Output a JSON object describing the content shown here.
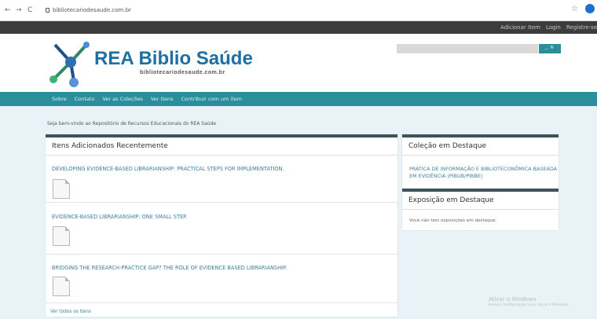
{
  "browser": {
    "back": "←",
    "forward": "→",
    "reload": "C",
    "url": "bibliotecariodesaude.com.br",
    "star_icon": "star-icon",
    "profile_icon": "profile-icon"
  },
  "topbar": {
    "links": [
      "Adicionar Item",
      "Login",
      "Registre-se"
    ]
  },
  "header": {
    "logo_title": "REA Biblio Saúde",
    "logo_subtitle": "bibliotecariodesaude.com.br",
    "search_button": "... 🔍"
  },
  "nav": {
    "items": [
      "Sobre",
      "Contato",
      "Ver as Coleções",
      "Ver Itens",
      "Contribuir com um item"
    ]
  },
  "welcome": "Seja bem-vindo ao Repositório de Recursos Educacionais do REA Saúde",
  "recent": {
    "title": "Itens Adicionados Recentemente",
    "items": [
      "DEVELOPING EVIDENCE-BASED LIBRARIANSHIP: PRACTICAL STEPS FOR IMPLEMENTATION.",
      "EVIDENCE-BASED LIBRARIANSHIP: ONE SMALL STEP.",
      "BRIDGING THE RESEARCH-PRACTICE GAP? THE ROLE OF EVIDENCE BASED LIBRARIANSHIP."
    ],
    "view_all": "Ver todos os itens"
  },
  "featured_collection": {
    "title": "Coleção em Destaque",
    "link": "PRÁTICA DE INFORMAÇÃO E BIBLIOTECONÔMICA BASEADA EM EVIDÊNCIA (PIBUB/PIBBE)"
  },
  "featured_exhibit": {
    "title": "Exposição em Destaque",
    "message": "Você não tem exposições em destaque."
  },
  "watermark": {
    "line1": "Ativar o Windows",
    "line2": "Acesse Configurações para ativar o Windows."
  },
  "colors": {
    "teal": "#2b8f9b",
    "dark_bar": "#3c3c3c",
    "link": "#3f7fa0",
    "logo_blue": "#1f6fa2"
  }
}
